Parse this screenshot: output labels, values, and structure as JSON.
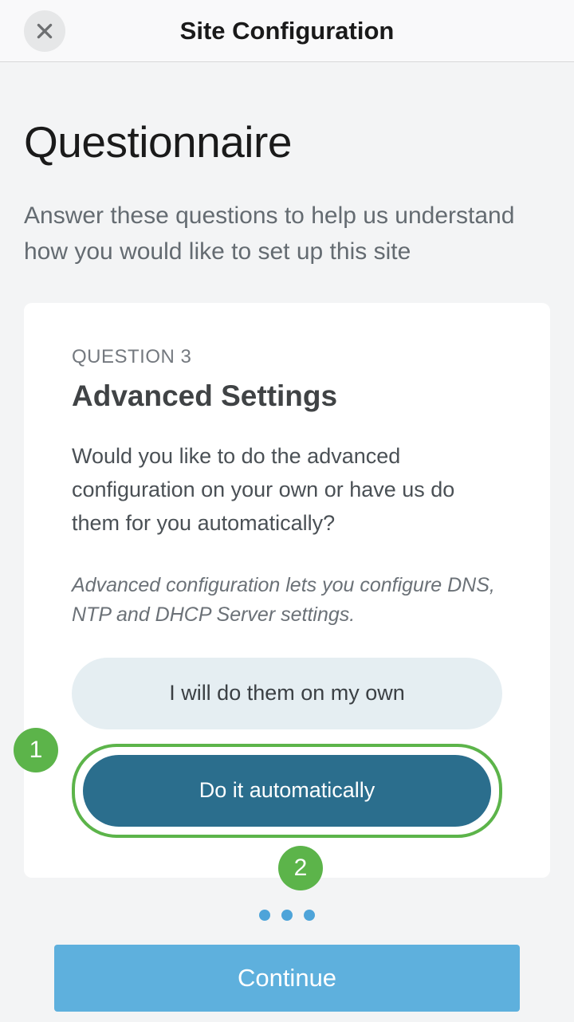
{
  "header": {
    "title": "Site Configuration"
  },
  "page": {
    "title": "Questionnaire",
    "subtitle": "Answer these questions to help us understand how you would like to set up this site"
  },
  "question": {
    "label": "QUESTION 3",
    "title": "Advanced Settings",
    "text": "Would you like to do the advanced configuration on your own or have us do them for you automatically?",
    "note": "Advanced configuration lets you configure DNS, NTP and DHCP Server settings.",
    "option_unselected": "I will do them on my own",
    "option_selected": "Do it automatically"
  },
  "continue_label": "Continue",
  "annotations": {
    "badge1": "1",
    "badge2": "2"
  },
  "colors": {
    "accent_green": "#5cb44a",
    "accent_blue": "#5eb0dd",
    "selected_bg": "#2b6e8d"
  }
}
